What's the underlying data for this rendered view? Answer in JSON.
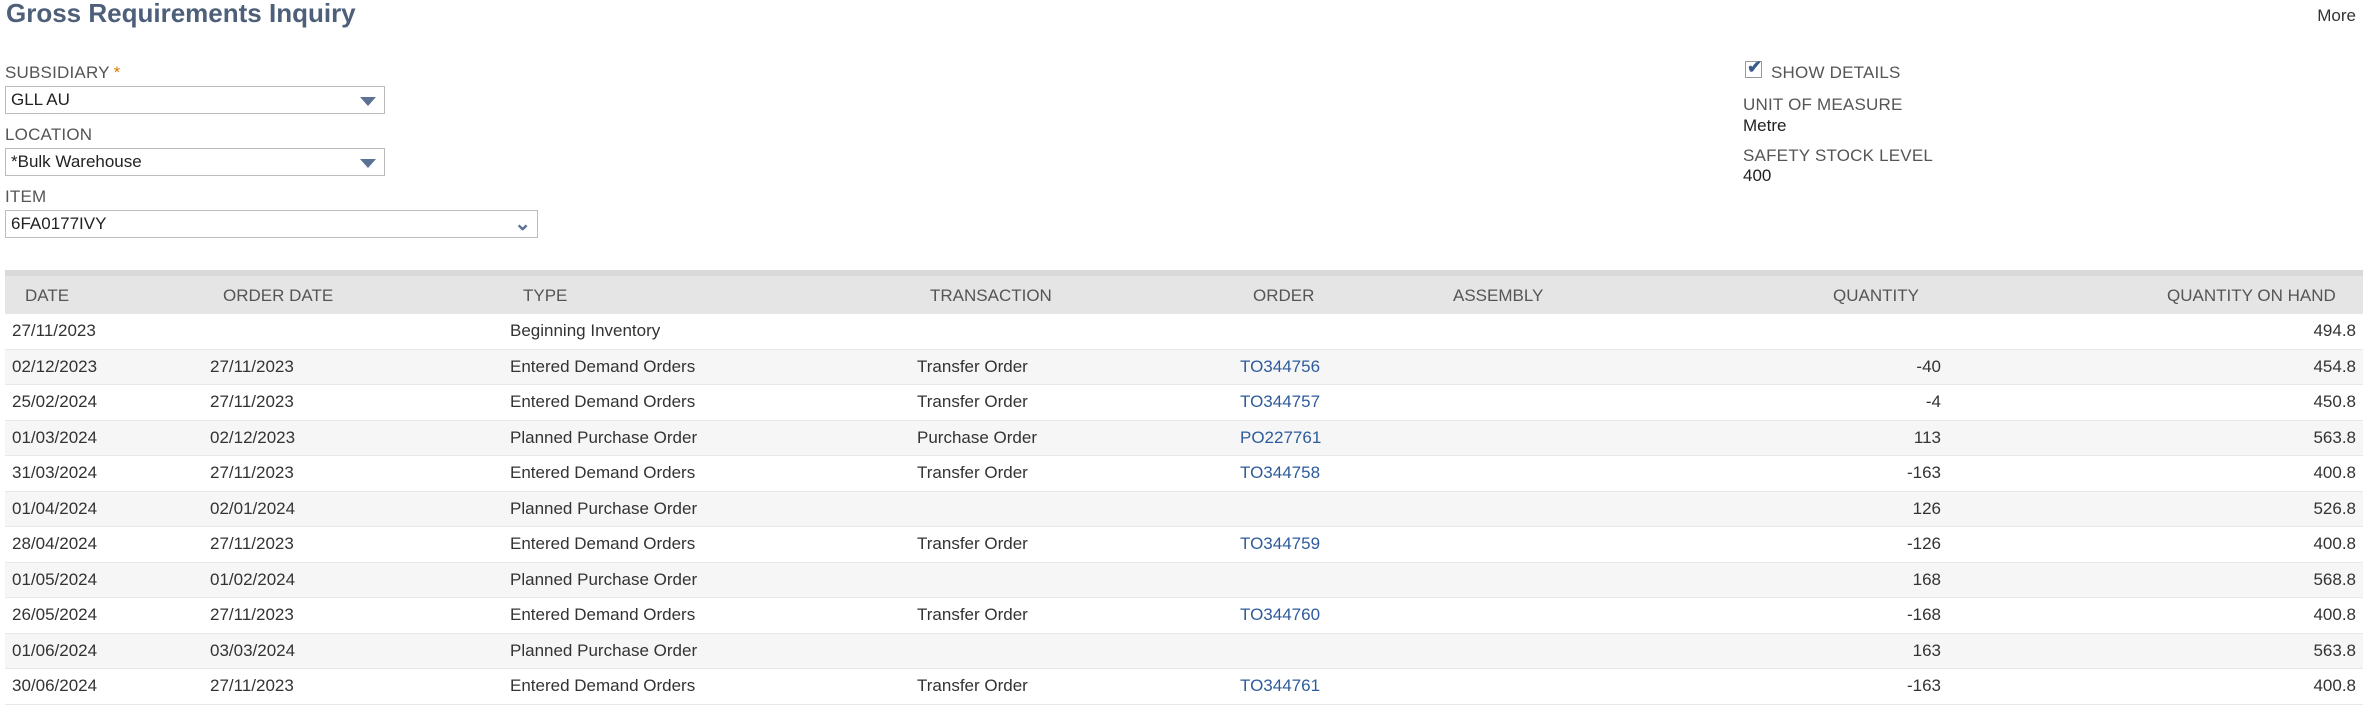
{
  "page": {
    "title": "Gross Requirements Inquiry",
    "more_label": "More"
  },
  "filters": {
    "subsidiary": {
      "label": "SUBSIDIARY",
      "required_mark": "*",
      "value": "GLL AU"
    },
    "location": {
      "label": "LOCATION",
      "value": "*Bulk Warehouse"
    },
    "item": {
      "label": "ITEM",
      "value": "6FA0177IVY"
    }
  },
  "details": {
    "show_details_label": "SHOW DETAILS",
    "show_details_checked": true,
    "unit_label": "UNIT OF MEASURE",
    "unit_value": "Metre",
    "safety_label": "SAFETY STOCK LEVEL",
    "safety_value": "400"
  },
  "table": {
    "headers": {
      "date": "DATE",
      "order_date": "ORDER DATE",
      "type": "TYPE",
      "transaction": "TRANSACTION",
      "order": "ORDER",
      "assembly": "ASSEMBLY",
      "quantity": "QUANTITY",
      "qoh": "QUANTITY ON HAND"
    },
    "rows": [
      {
        "date": "27/11/2023",
        "order_date": "",
        "type": "Beginning Inventory",
        "transaction": "",
        "order": "",
        "assembly": "",
        "quantity": "",
        "qoh": "494.8"
      },
      {
        "date": "02/12/2023",
        "order_date": "27/11/2023",
        "type": "Entered Demand Orders",
        "transaction": "Transfer Order",
        "order": "TO344756",
        "assembly": "",
        "quantity": "-40",
        "qoh": "454.8"
      },
      {
        "date": "25/02/2024",
        "order_date": "27/11/2023",
        "type": "Entered Demand Orders",
        "transaction": "Transfer Order",
        "order": "TO344757",
        "assembly": "",
        "quantity": "-4",
        "qoh": "450.8"
      },
      {
        "date": "01/03/2024",
        "order_date": "02/12/2023",
        "type": "Planned Purchase Order",
        "transaction": "Purchase Order",
        "order": "PO227761",
        "assembly": "",
        "quantity": "113",
        "qoh": "563.8"
      },
      {
        "date": "31/03/2024",
        "order_date": "27/11/2023",
        "type": "Entered Demand Orders",
        "transaction": "Transfer Order",
        "order": "TO344758",
        "assembly": "",
        "quantity": "-163",
        "qoh": "400.8"
      },
      {
        "date": "01/04/2024",
        "order_date": "02/01/2024",
        "type": "Planned Purchase Order",
        "transaction": "",
        "order": "",
        "assembly": "",
        "quantity": "126",
        "qoh": "526.8"
      },
      {
        "date": "28/04/2024",
        "order_date": "27/11/2023",
        "type": "Entered Demand Orders",
        "transaction": "Transfer Order",
        "order": "TO344759",
        "assembly": "",
        "quantity": "-126",
        "qoh": "400.8"
      },
      {
        "date": "01/05/2024",
        "order_date": "01/02/2024",
        "type": "Planned Purchase Order",
        "transaction": "",
        "order": "",
        "assembly": "",
        "quantity": "168",
        "qoh": "568.8"
      },
      {
        "date": "26/05/2024",
        "order_date": "27/11/2023",
        "type": "Entered Demand Orders",
        "transaction": "Transfer Order",
        "order": "TO344760",
        "assembly": "",
        "quantity": "-168",
        "qoh": "400.8"
      },
      {
        "date": "01/06/2024",
        "order_date": "03/03/2024",
        "type": "Planned Purchase Order",
        "transaction": "",
        "order": "",
        "assembly": "",
        "quantity": "163",
        "qoh": "563.8"
      },
      {
        "date": "30/06/2024",
        "order_date": "27/11/2023",
        "type": "Entered Demand Orders",
        "transaction": "Transfer Order",
        "order": "TO344761",
        "assembly": "",
        "quantity": "-163",
        "qoh": "400.8"
      }
    ]
  }
}
